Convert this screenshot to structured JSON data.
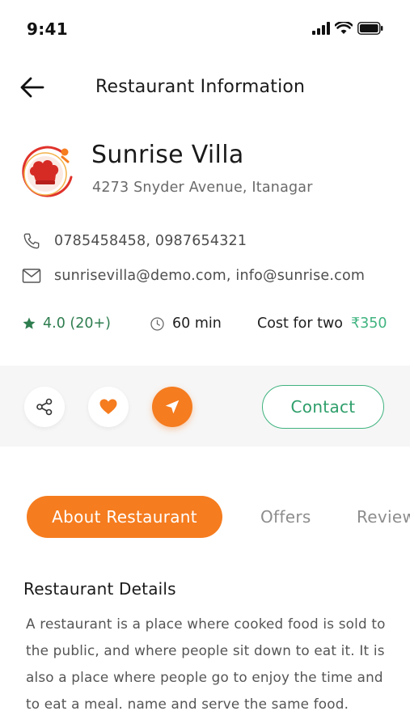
{
  "status_bar": {
    "time": "9:41"
  },
  "header": {
    "title": "Restaurant Information",
    "back_icon": "arrow-left-icon"
  },
  "restaurant": {
    "name": "Sunrise Villa",
    "address": "4273 Snyder Avenue, Itanagar",
    "phone": "0785458458, 0987654321",
    "email": "sunrisevilla@demo.com, info@sunrise.com",
    "rating": "4.0 (20+)",
    "delivery_time": "60 min",
    "cost_label": "Cost for two",
    "cost_value": "₹350"
  },
  "actions": {
    "contact_label": "Contact",
    "icons": [
      "share-icon",
      "heart-icon",
      "navigation-icon"
    ]
  },
  "tabs": [
    {
      "label": "About Restaurant",
      "active": true
    },
    {
      "label": "Offers",
      "active": false
    },
    {
      "label": "Review",
      "active": false
    }
  ],
  "details": {
    "title": "Restaurant Details",
    "body": "A restaurant is a place where cooked food is sold to the public, and where people sit down to eat it. It is also a place where people go to enjoy the time and to eat a meal.  name and serve the same food."
  },
  "colors": {
    "accent": "#f57c1f",
    "green": "#3fb37f",
    "rating_green": "#2e7d4f"
  }
}
